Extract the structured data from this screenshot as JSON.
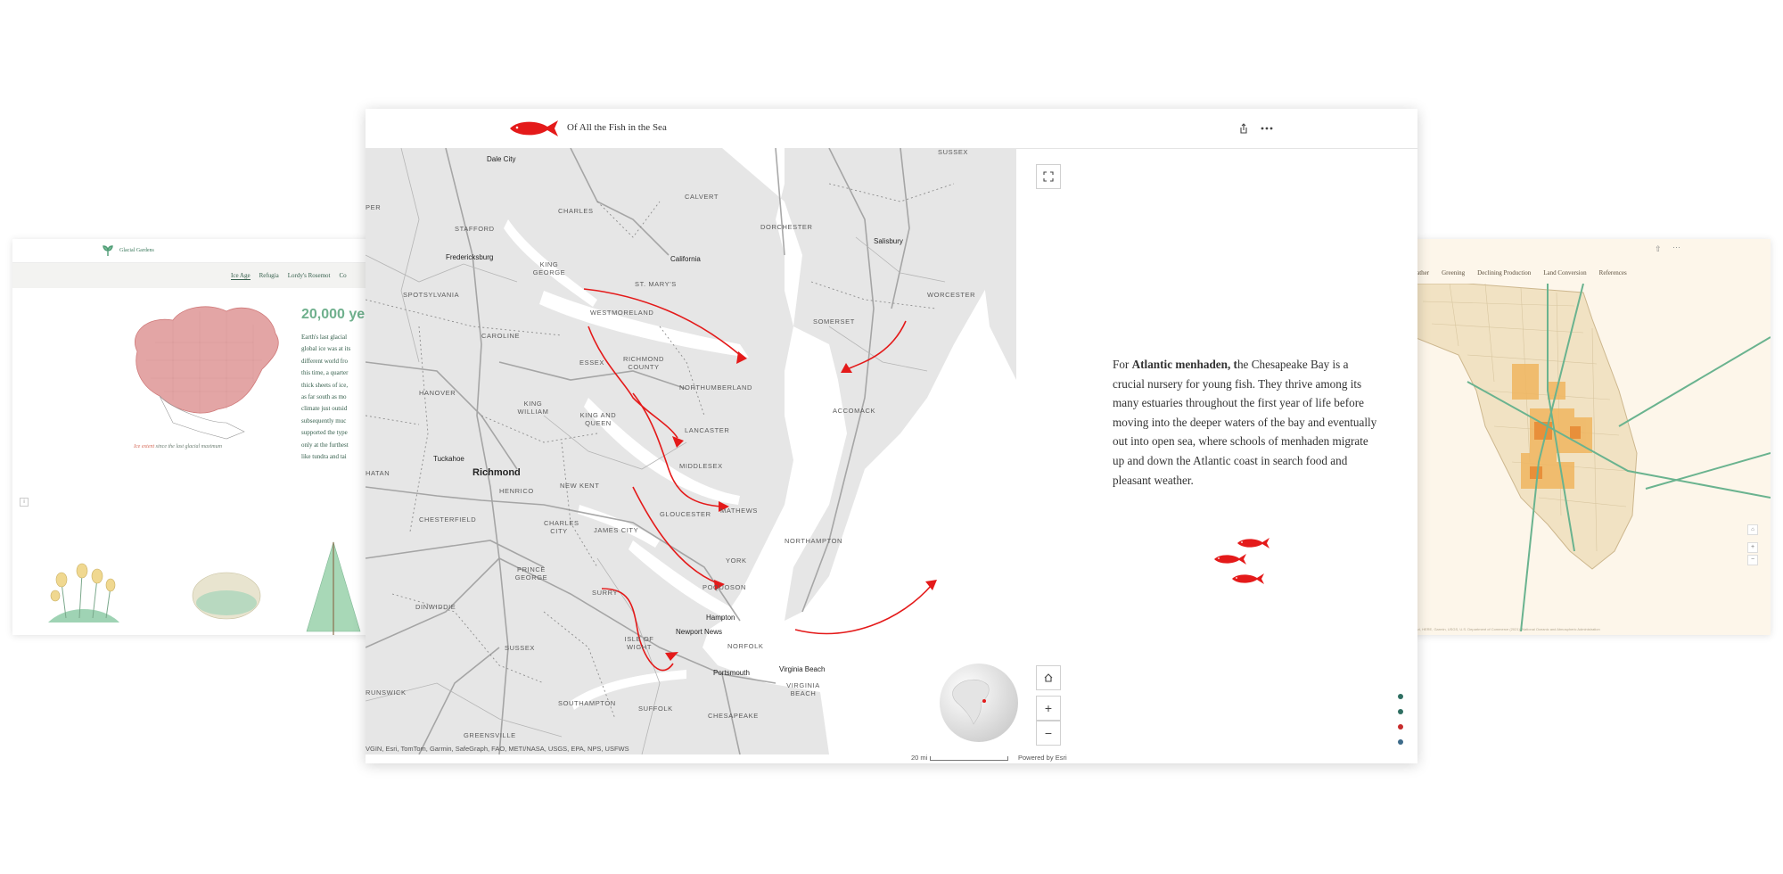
{
  "left_card": {
    "brand": "Glacial Gardens",
    "nav": [
      "Ice Age",
      "Refugia",
      "Lordy's Rosemot",
      "Co"
    ],
    "heading": "20,000 ye",
    "body_lines": [
      "Earth's last glacial",
      "global ice was at its",
      "different world fro",
      "this time, a quarter",
      "thick sheets of ice,",
      "as far south as mo",
      "climate just outsid",
      "subsequently muc",
      "supported the type",
      "only at the furthest",
      "like tundra and tai"
    ],
    "caption_highlight": "Ice extent",
    "caption_rest": " since the last glacial maximum"
  },
  "right_card": {
    "nav": [
      "eather",
      "Greening",
      "Declining Production",
      "Land Conversion",
      "References"
    ],
    "attribution": "Esri, HERE, Garmin, USGS, U.S. Department of Commerce (2021), National Oceanic and Atmospheric Administration"
  },
  "main": {
    "title": "Of All the Fish in the Sea",
    "share_icon": "share-icon",
    "more_icon": "more-icon",
    "map": {
      "county_labels": [
        "CALVERT",
        "DORCHESTER",
        "CHARLES",
        "STAFFORD",
        "KING GEORGE",
        "ST. MARY'S",
        "SPOTSYLVANIA",
        "WESTMORELAND",
        "CAROLINE",
        "ESSEX",
        "RICHMOND COUNTY",
        "HANOVER",
        "KING WILLIAM",
        "KING AND QUEEN",
        "NORTHUMBERLAND",
        "LANCASTER",
        "MIDDLESEX",
        "HENRICO",
        "NEW KENT",
        "CHESTERFIELD",
        "CHARLES CITY",
        "JAMES CITY",
        "GLOUCESTER",
        "MATHEWS",
        "YORK",
        "PRINCE GEORGE",
        "SURRY",
        "POQUOSON",
        "DINWIDDIE",
        "ISLE OF WIGHT",
        "NORFOLK",
        "SUSSEX",
        "SOUTHAMPTON",
        "SUFFOLK",
        "CHESAPEAKE",
        "VIRGINIA BEACH",
        "SOMERSET",
        "WORCESTER",
        "ACCOMACK",
        "NORTHAMPTON",
        "SUSSEX",
        "GREENSVILLE",
        "RUNSWICK",
        "HATAN",
        "PER"
      ],
      "cities": [
        "Dale City",
        "Fredericksburg",
        "California",
        "Salisbury",
        "Tuckahoe",
        "Richmond",
        "Hampton",
        "Newport News",
        "Portsmouth",
        "Virginia Beach"
      ],
      "attribution": "VGIN, Esri, TomTom, Garmin, SafeGraph, FAO, METI/NASA, USGS, EPA, NPS, USFWS",
      "scale": "20 mi",
      "powered": "Powered by Esri"
    },
    "narrative_prefix": "For ",
    "narrative_bold": "Atlantic menhaden, t",
    "narrative_rest": "he Chesapeake Bay is a crucial nursery for young fish. They thrive among its many estuaries throughout the first year of life before moving into the deeper waters of the bay and eventually out into open sea, where schools of menhaden migrate up and down the Atlantic coast in search food and pleasant weather.",
    "accent_color": "#e41a1a",
    "nav_dots": [
      "#2f6f62",
      "#2f6f62",
      "#c72c2c",
      "#3d6b8a"
    ]
  }
}
